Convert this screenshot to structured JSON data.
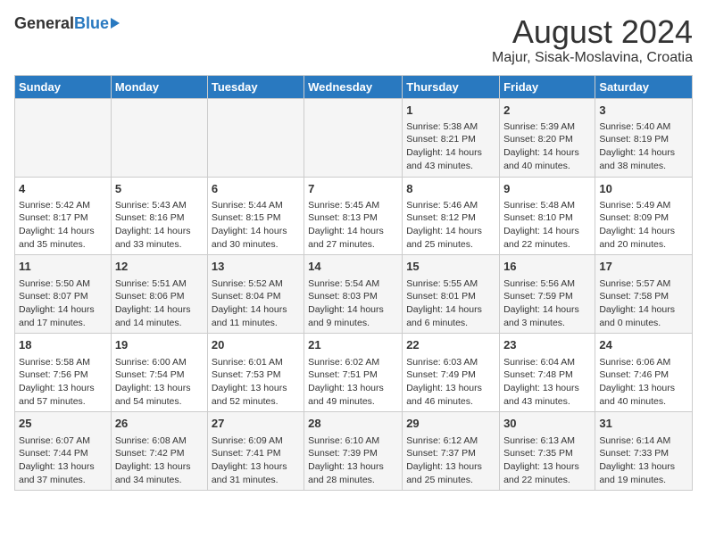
{
  "header": {
    "logo_general": "General",
    "logo_blue": "Blue",
    "month": "August 2024",
    "location": "Majur, Sisak-Moslavina, Croatia"
  },
  "days_of_week": [
    "Sunday",
    "Monday",
    "Tuesday",
    "Wednesday",
    "Thursday",
    "Friday",
    "Saturday"
  ],
  "weeks": [
    [
      {
        "day": "",
        "info": ""
      },
      {
        "day": "",
        "info": ""
      },
      {
        "day": "",
        "info": ""
      },
      {
        "day": "",
        "info": ""
      },
      {
        "day": "1",
        "info": "Sunrise: 5:38 AM\nSunset: 8:21 PM\nDaylight: 14 hours\nand 43 minutes."
      },
      {
        "day": "2",
        "info": "Sunrise: 5:39 AM\nSunset: 8:20 PM\nDaylight: 14 hours\nand 40 minutes."
      },
      {
        "day": "3",
        "info": "Sunrise: 5:40 AM\nSunset: 8:19 PM\nDaylight: 14 hours\nand 38 minutes."
      }
    ],
    [
      {
        "day": "4",
        "info": "Sunrise: 5:42 AM\nSunset: 8:17 PM\nDaylight: 14 hours\nand 35 minutes."
      },
      {
        "day": "5",
        "info": "Sunrise: 5:43 AM\nSunset: 8:16 PM\nDaylight: 14 hours\nand 33 minutes."
      },
      {
        "day": "6",
        "info": "Sunrise: 5:44 AM\nSunset: 8:15 PM\nDaylight: 14 hours\nand 30 minutes."
      },
      {
        "day": "7",
        "info": "Sunrise: 5:45 AM\nSunset: 8:13 PM\nDaylight: 14 hours\nand 27 minutes."
      },
      {
        "day": "8",
        "info": "Sunrise: 5:46 AM\nSunset: 8:12 PM\nDaylight: 14 hours\nand 25 minutes."
      },
      {
        "day": "9",
        "info": "Sunrise: 5:48 AM\nSunset: 8:10 PM\nDaylight: 14 hours\nand 22 minutes."
      },
      {
        "day": "10",
        "info": "Sunrise: 5:49 AM\nSunset: 8:09 PM\nDaylight: 14 hours\nand 20 minutes."
      }
    ],
    [
      {
        "day": "11",
        "info": "Sunrise: 5:50 AM\nSunset: 8:07 PM\nDaylight: 14 hours\nand 17 minutes."
      },
      {
        "day": "12",
        "info": "Sunrise: 5:51 AM\nSunset: 8:06 PM\nDaylight: 14 hours\nand 14 minutes."
      },
      {
        "day": "13",
        "info": "Sunrise: 5:52 AM\nSunset: 8:04 PM\nDaylight: 14 hours\nand 11 minutes."
      },
      {
        "day": "14",
        "info": "Sunrise: 5:54 AM\nSunset: 8:03 PM\nDaylight: 14 hours\nand 9 minutes."
      },
      {
        "day": "15",
        "info": "Sunrise: 5:55 AM\nSunset: 8:01 PM\nDaylight: 14 hours\nand 6 minutes."
      },
      {
        "day": "16",
        "info": "Sunrise: 5:56 AM\nSunset: 7:59 PM\nDaylight: 14 hours\nand 3 minutes."
      },
      {
        "day": "17",
        "info": "Sunrise: 5:57 AM\nSunset: 7:58 PM\nDaylight: 14 hours\nand 0 minutes."
      }
    ],
    [
      {
        "day": "18",
        "info": "Sunrise: 5:58 AM\nSunset: 7:56 PM\nDaylight: 13 hours\nand 57 minutes."
      },
      {
        "day": "19",
        "info": "Sunrise: 6:00 AM\nSunset: 7:54 PM\nDaylight: 13 hours\nand 54 minutes."
      },
      {
        "day": "20",
        "info": "Sunrise: 6:01 AM\nSunset: 7:53 PM\nDaylight: 13 hours\nand 52 minutes."
      },
      {
        "day": "21",
        "info": "Sunrise: 6:02 AM\nSunset: 7:51 PM\nDaylight: 13 hours\nand 49 minutes."
      },
      {
        "day": "22",
        "info": "Sunrise: 6:03 AM\nSunset: 7:49 PM\nDaylight: 13 hours\nand 46 minutes."
      },
      {
        "day": "23",
        "info": "Sunrise: 6:04 AM\nSunset: 7:48 PM\nDaylight: 13 hours\nand 43 minutes."
      },
      {
        "day": "24",
        "info": "Sunrise: 6:06 AM\nSunset: 7:46 PM\nDaylight: 13 hours\nand 40 minutes."
      }
    ],
    [
      {
        "day": "25",
        "info": "Sunrise: 6:07 AM\nSunset: 7:44 PM\nDaylight: 13 hours\nand 37 minutes."
      },
      {
        "day": "26",
        "info": "Sunrise: 6:08 AM\nSunset: 7:42 PM\nDaylight: 13 hours\nand 34 minutes."
      },
      {
        "day": "27",
        "info": "Sunrise: 6:09 AM\nSunset: 7:41 PM\nDaylight: 13 hours\nand 31 minutes."
      },
      {
        "day": "28",
        "info": "Sunrise: 6:10 AM\nSunset: 7:39 PM\nDaylight: 13 hours\nand 28 minutes."
      },
      {
        "day": "29",
        "info": "Sunrise: 6:12 AM\nSunset: 7:37 PM\nDaylight: 13 hours\nand 25 minutes."
      },
      {
        "day": "30",
        "info": "Sunrise: 6:13 AM\nSunset: 7:35 PM\nDaylight: 13 hours\nand 22 minutes."
      },
      {
        "day": "31",
        "info": "Sunrise: 6:14 AM\nSunset: 7:33 PM\nDaylight: 13 hours\nand 19 minutes."
      }
    ]
  ]
}
